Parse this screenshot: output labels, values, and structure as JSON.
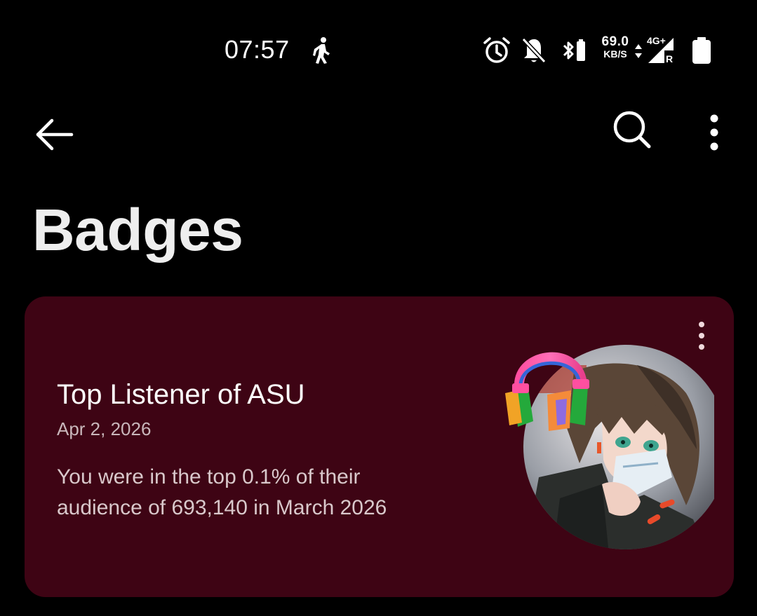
{
  "status_bar": {
    "time": "07:57",
    "net_speed_value": "69.0",
    "net_speed_unit": "KB/S",
    "network_type": "4G+",
    "roaming": "R",
    "icons": [
      "walk-icon",
      "alarm-icon",
      "bell-off-icon",
      "bluetooth-icon",
      "data-updown-icon",
      "signal-icon",
      "battery-icon"
    ]
  },
  "app_bar": {
    "back_icon": "arrow-left-icon",
    "search_icon": "search-icon",
    "more_icon": "more-vert-icon"
  },
  "page": {
    "title": "Badges"
  },
  "badges": [
    {
      "title": "Top Listener of ASU",
      "date": "Apr 2, 2026",
      "description": "You were in the top 0.1% of their audience of 693,140 in March 2026",
      "artwork": "artist-avatar-with-headphones"
    }
  ],
  "colors": {
    "background": "#000000",
    "card_background": "#3e0414",
    "text_primary": "#ffffff",
    "text_secondary": "#c9b7bb"
  }
}
